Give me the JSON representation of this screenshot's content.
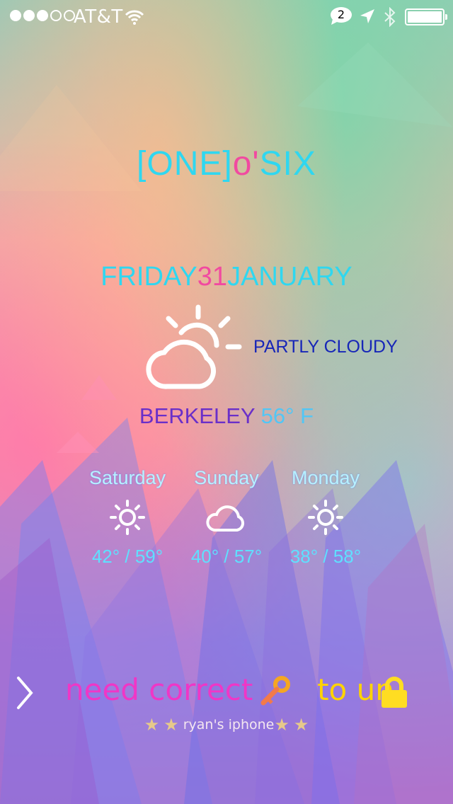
{
  "status_bar": {
    "carrier": "AT&T",
    "signal_bars_filled": 3,
    "signal_bars_total": 5,
    "notification_count": "2",
    "battery_level_percent": 100
  },
  "clock": {
    "part1": "[ONE]",
    "part2": "o'",
    "part3": "SIX"
  },
  "date": {
    "weekday": "FRIDAY",
    "day": "31",
    "month": "JANUARY"
  },
  "weather": {
    "condition": "PARTLY CLOUDY",
    "icon": "partly-cloudy-icon",
    "city": "BERKELEY",
    "temp": "56°",
    "unit": "F"
  },
  "forecast": [
    {
      "day": "Saturday",
      "icon": "sun-icon",
      "low": "42°",
      "high": "/ 59°"
    },
    {
      "day": "Sunday",
      "icon": "cloud-icon",
      "low": "40°",
      "high": "/ 57°"
    },
    {
      "day": "Monday",
      "icon": "sun-icon",
      "low": "38°",
      "high": "/ 58°"
    }
  ],
  "unlock": {
    "text_main": "need correct",
    "text_end": "to un",
    "key_icon": "key-icon",
    "lock_icon": "lock-icon"
  },
  "owner": {
    "name": "ryan's iphone"
  },
  "colors": {
    "accent_cyan": "#2fd7f0",
    "accent_pink": "#f14aa0",
    "condition_blue": "#1726b8",
    "slide_magenta": "#f036c6",
    "slide_yellow": "#ffd300"
  }
}
